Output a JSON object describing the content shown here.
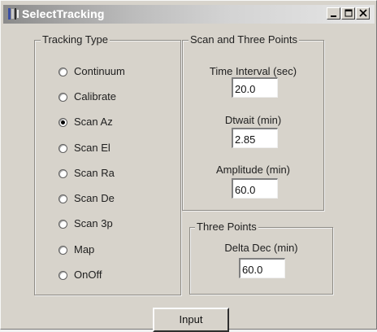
{
  "window": {
    "title": "SelectTracking",
    "icon": "app-icon",
    "buttons": {
      "minimize": "minimize-icon",
      "maximize": "maximize-icon",
      "close": "close-icon"
    }
  },
  "tracking_type": {
    "label": "Tracking Type",
    "selected": "Scan Az",
    "options": [
      {
        "label": "Continuum",
        "checked": false
      },
      {
        "label": "Calibrate",
        "checked": false
      },
      {
        "label": "Scan Az",
        "checked": true
      },
      {
        "label": "Scan El",
        "checked": false
      },
      {
        "label": "Scan Ra",
        "checked": false
      },
      {
        "label": "Scan De",
        "checked": false
      },
      {
        "label": "Scan 3p",
        "checked": false
      },
      {
        "label": "Map",
        "checked": false
      },
      {
        "label": "OnOff",
        "checked": false
      }
    ]
  },
  "scan_and_three_points": {
    "label": "Scan and Three Points",
    "time_interval": {
      "label": "Time Interval (sec)",
      "value": "20.0"
    },
    "dtwait": {
      "label": "Dtwait (min)",
      "value": "2.85"
    },
    "amplitude": {
      "label": "Amplitude (min)",
      "value": "60.0"
    }
  },
  "three_points": {
    "label": "Three Points",
    "delta_dec": {
      "label": "Delta Dec (min)",
      "value": "60.0"
    }
  },
  "actions": {
    "input_label": "Input"
  },
  "colors": {
    "face": "#d7d3cb",
    "title_gradient_start": "#8a8a8a",
    "title_gradient_end": "#e6e6e6",
    "group_border": "#8f8c86"
  }
}
